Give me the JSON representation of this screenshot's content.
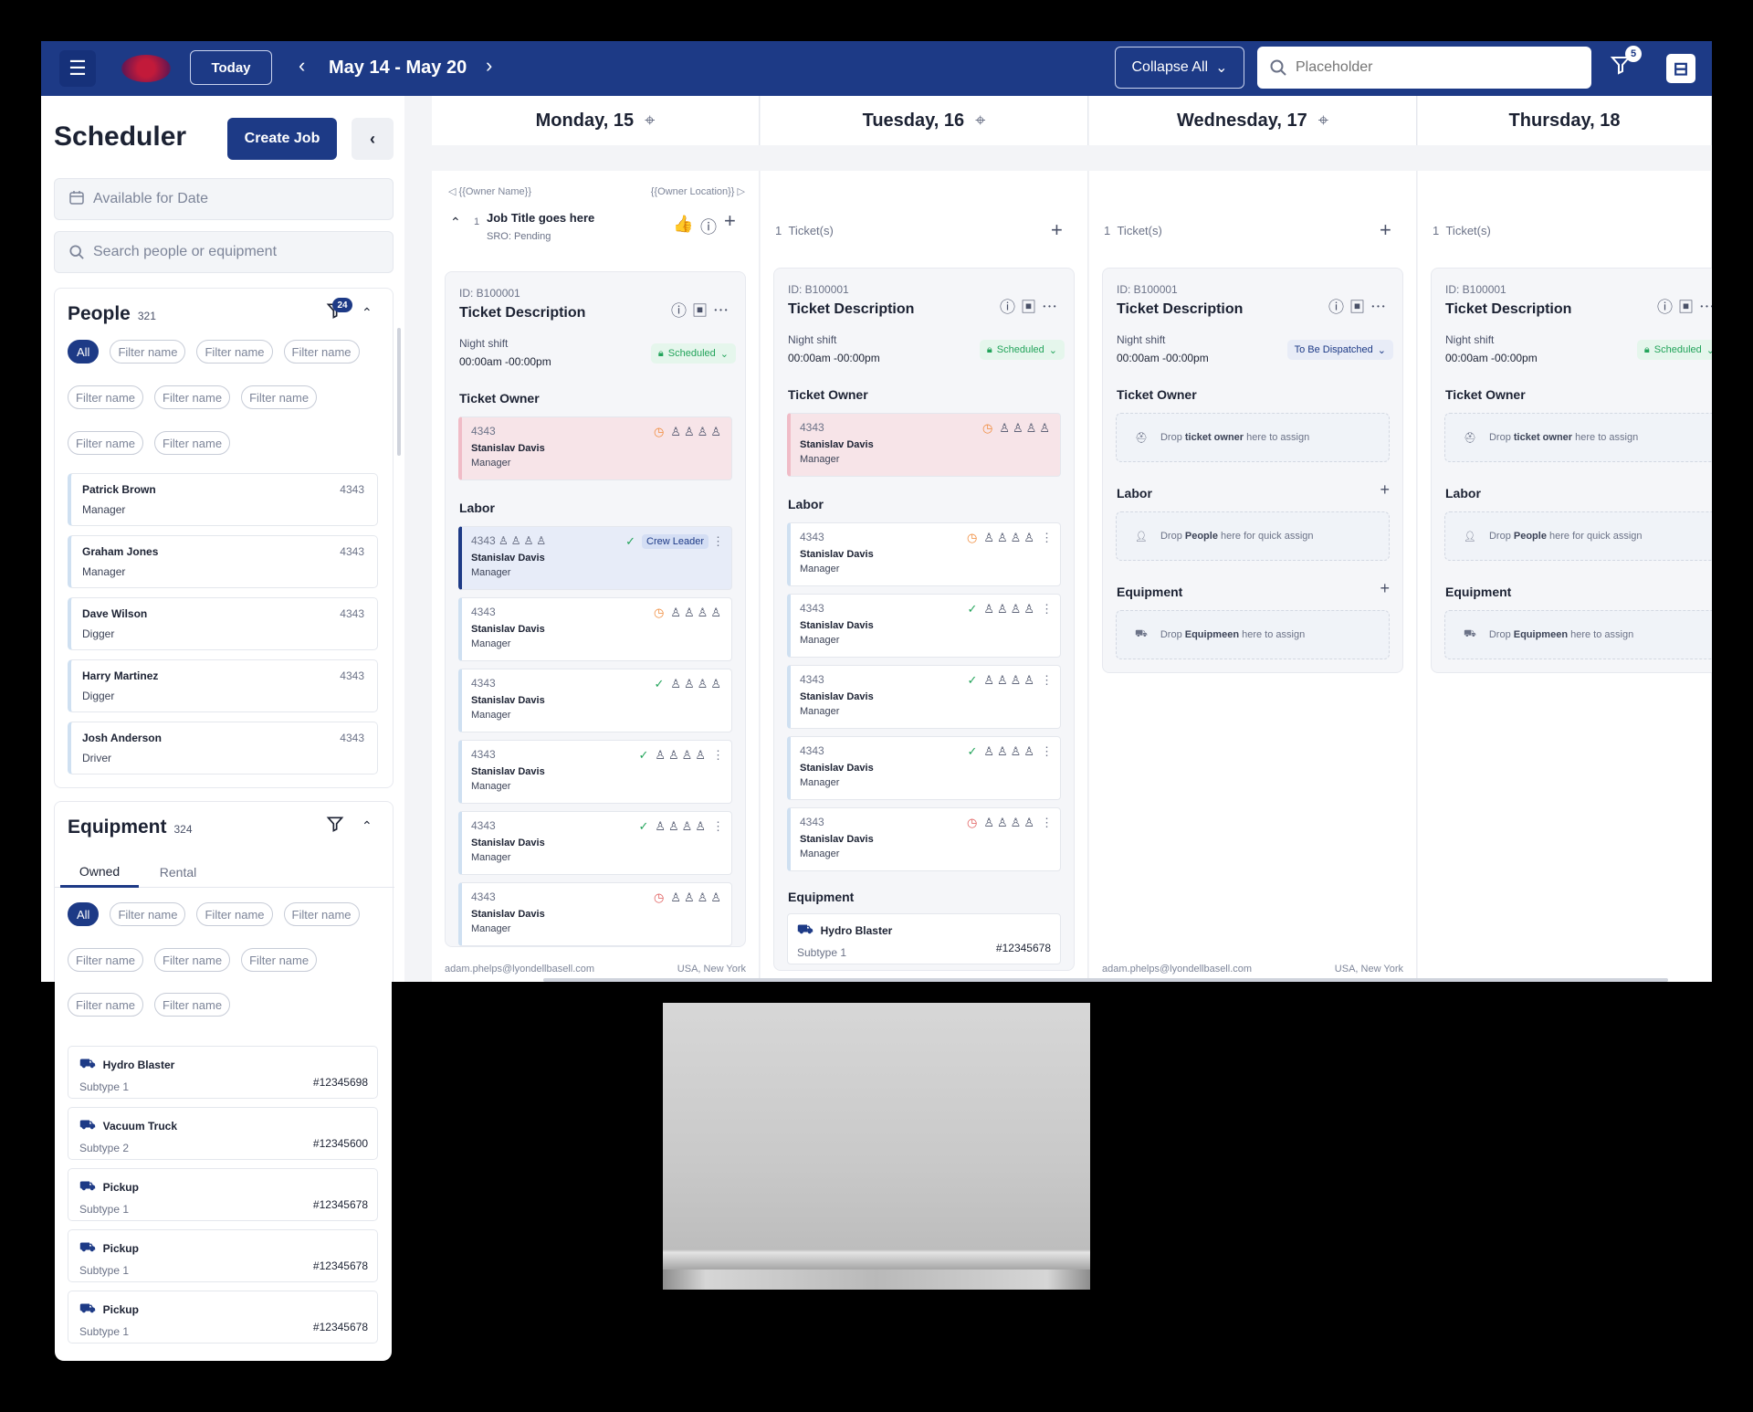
{
  "topbar": {
    "today": "Today",
    "date_range": "May 14 - May 20",
    "collapse_all": "Collapse All",
    "search_placeholder": "Placeholder",
    "filter_badge": "5"
  },
  "sidebar": {
    "title": "Scheduler",
    "create_job": "Create Job",
    "available_placeholder": "Available for Date",
    "search_placeholder": "Search people or equipment",
    "people": {
      "title": "People",
      "count": "321",
      "filter_badge": "24",
      "chips": [
        "All",
        "Filter name",
        "Filter name",
        "Filter name",
        "Filter name",
        "Filter name",
        "Filter name",
        "Filter name",
        "Filter name"
      ],
      "items": [
        {
          "name": "Patrick Brown",
          "role": "Manager",
          "id": "4343"
        },
        {
          "name": "Graham  Jones",
          "role": "Manager",
          "id": "4343"
        },
        {
          "name": "Dave Wilson",
          "role": "Digger",
          "id": "4343"
        },
        {
          "name": "Harry Martinez",
          "role": "Digger",
          "id": "4343"
        },
        {
          "name": "Josh  Anderson",
          "role": "Driver",
          "id": "4343"
        }
      ]
    },
    "equipment": {
      "title": "Equipment",
      "count": "324",
      "tabs": [
        "Owned",
        "Rental"
      ],
      "chips": [
        "All",
        "Filter name",
        "Filter name",
        "Filter name",
        "Filter name",
        "Filter name",
        "Filter name",
        "Filter name",
        "Filter name"
      ],
      "items": [
        {
          "name": "Hydro Blaster",
          "subtype": "Subtype 1",
          "num": "#12345698"
        },
        {
          "name": "Vacuum Truck",
          "subtype": "Subtype 2",
          "num": "#12345600"
        },
        {
          "name": "Pickup",
          "subtype": "Subtype 1",
          "num": "#12345678"
        },
        {
          "name": "Pickup",
          "subtype": "Subtype 1",
          "num": "#12345678"
        },
        {
          "name": "Pickup",
          "subtype": "Subtype 1",
          "num": "#12345678"
        }
      ]
    }
  },
  "calendar": {
    "days": [
      "Monday, 15",
      "Tuesday, 16",
      "Wednesday, 17",
      "Thursday, 18"
    ],
    "monday": {
      "owner_name": "{{Owner Name}}",
      "owner_location": "{{Owner Location}}",
      "job_count": "1",
      "job_title": "Job Title goes here",
      "sro": "SRO: Pending",
      "footer_email": "adam.phelps@lyondellbasell.com",
      "footer_location": "USA, New York"
    },
    "tickets_label": "Ticket(s)",
    "tickets_count": "1",
    "ticket": {
      "id": "ID: B100001",
      "title": "Ticket Description",
      "shift": "Night shift",
      "time": "00:00am -00:00pm",
      "ticket_owner": "Ticket Owner",
      "labor": "Labor",
      "equipment": "Equipment"
    },
    "status": {
      "scheduled": "Scheduled",
      "dispatch": "To Be Dispatched"
    },
    "crew_leader": "Crew Leader",
    "labor_person": {
      "id": "4343",
      "name": "Stanislav Davis",
      "role": "Manager"
    },
    "drop": {
      "owner_pre": "Drop",
      "owner_b": "ticket owner",
      "owner_post": "here to assign",
      "people_pre": "Drop",
      "people_b": "People",
      "people_post": "here for quick assign",
      "equip_pre": "Drop",
      "equip_b": "Equipmeen",
      "equip_post": "here to assign"
    },
    "tuesday_equipment": {
      "name": "Hydro Blaster",
      "subtype": "Subtype 1",
      "num": "#12345678"
    },
    "wednesday_footer": {
      "email": "adam.phelps@lyondellbasell.com",
      "location": "USA, New York"
    }
  },
  "icons": {
    "menu": "hamburger-icon",
    "search": "search-icon",
    "filter": "filter-icon",
    "calendar": "calendar-icon",
    "crosshair": "crosshair-icon",
    "truck": "truck-icon",
    "clock": "clock-icon",
    "check": "check-circle-icon",
    "info": "info-icon",
    "thumbs": "thumbs-up-icon",
    "more": "more-horizontal-icon"
  },
  "colors": {
    "brand": "#1d3a86",
    "scheduled": "#23a45b",
    "warning": "#f08a3a",
    "owner_bg": "#f7e4e8"
  }
}
